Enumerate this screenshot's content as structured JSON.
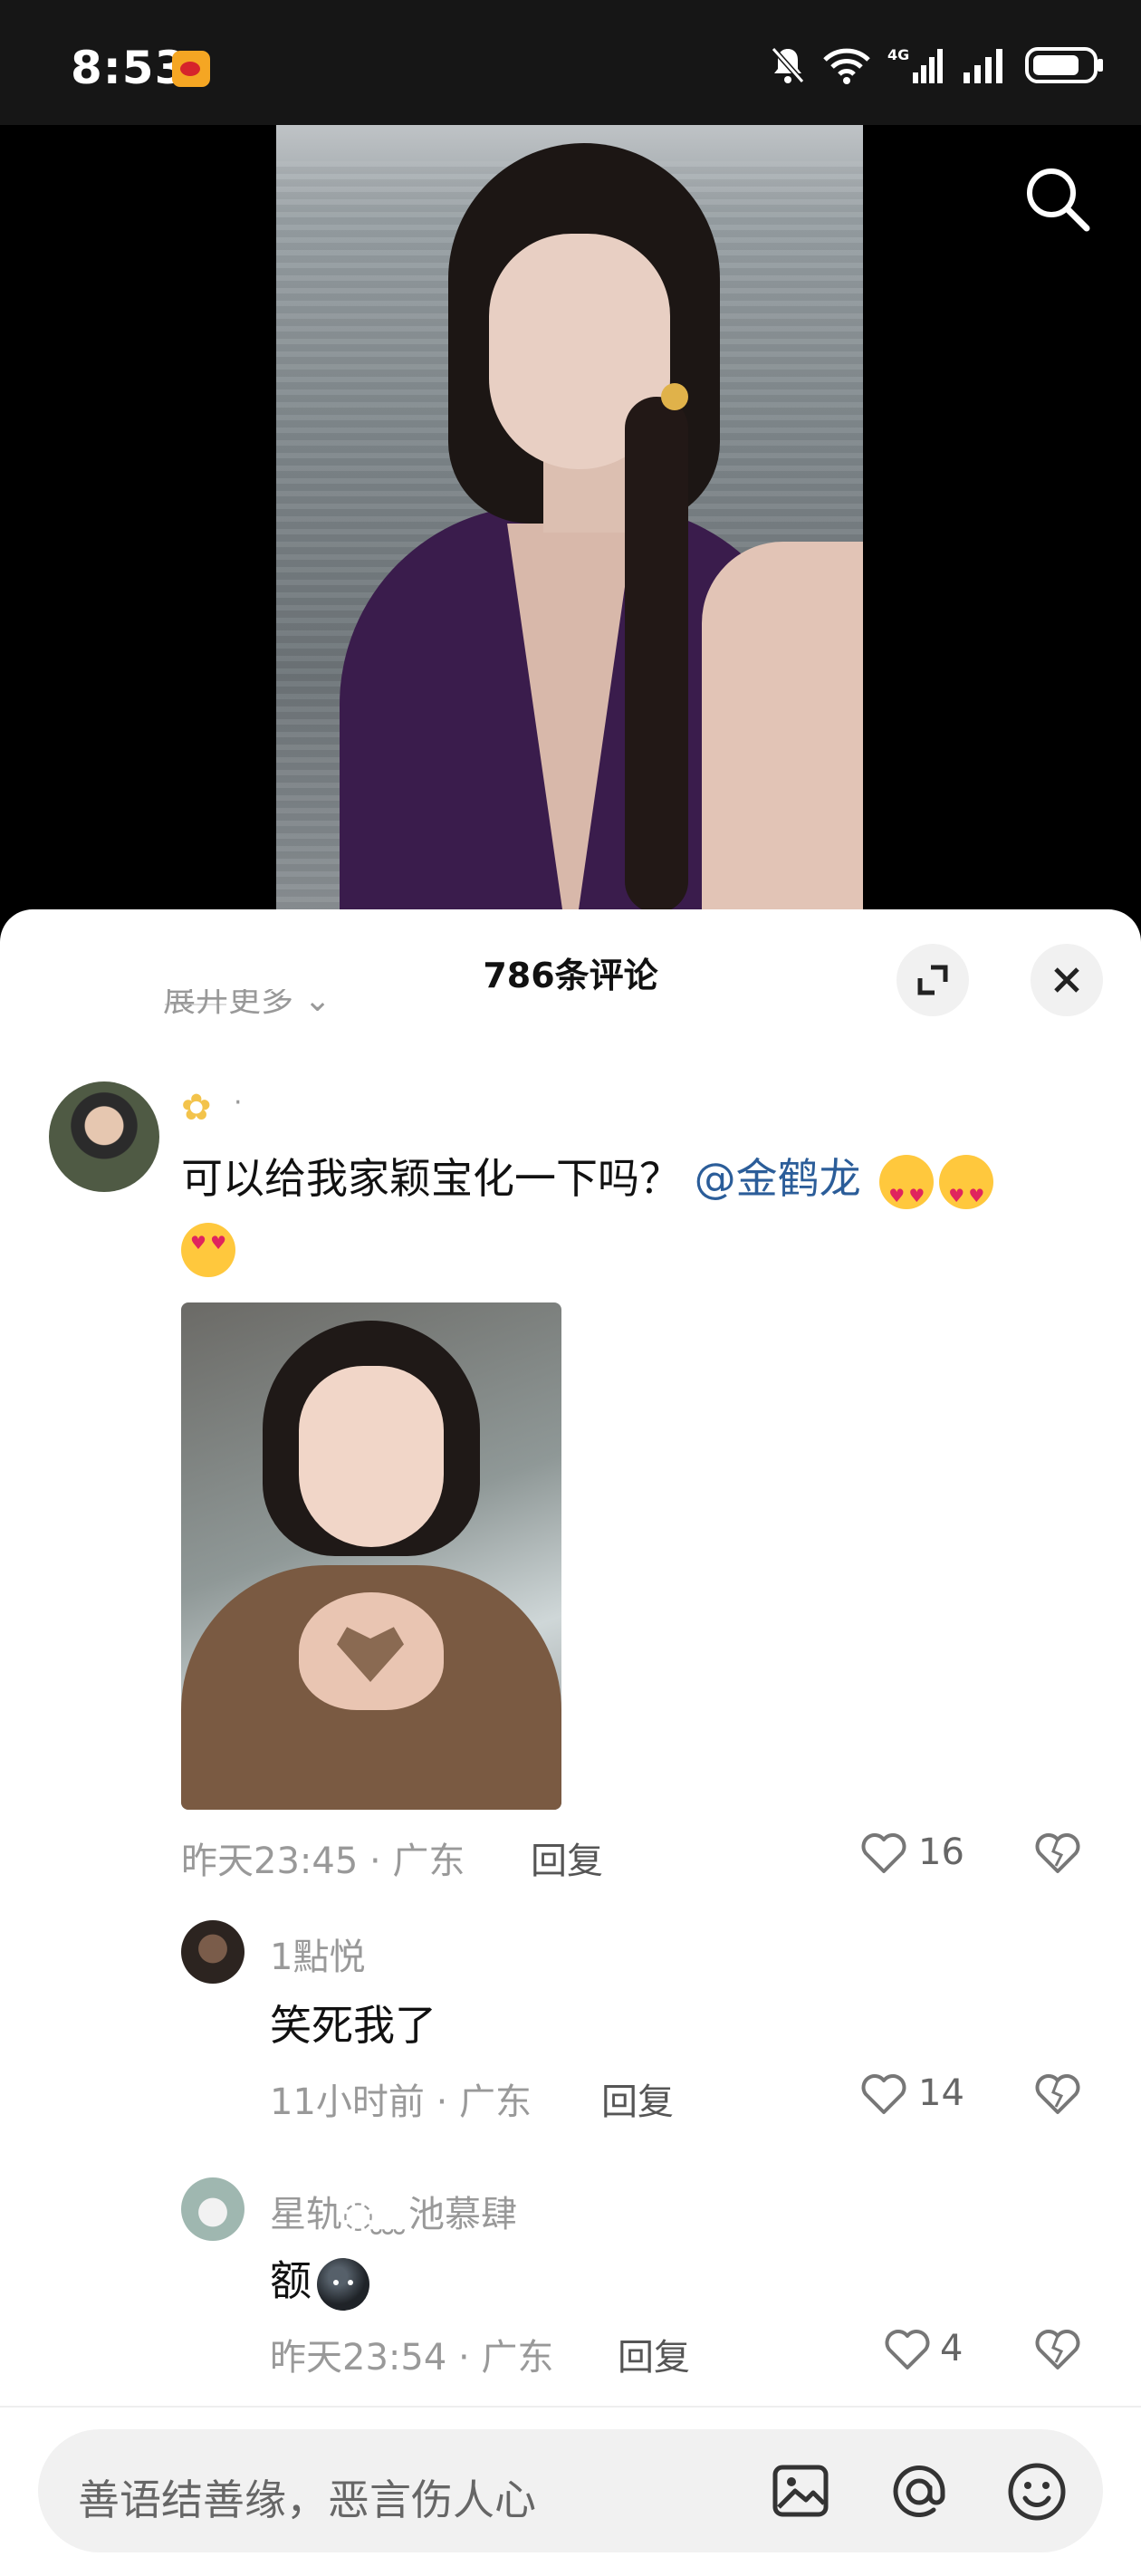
{
  "status_bar": {
    "time": "8:53",
    "app_icon": "weibo-icon",
    "icons": [
      "mute-bell-icon",
      "wifi-icon",
      "4g-signal-icon",
      "signal-icon",
      "battery-icon"
    ],
    "network_label": "4G"
  },
  "video": {
    "search_icon": "search-icon"
  },
  "comments_sheet": {
    "title": "786条评论",
    "expand_more": "展开更多",
    "main_comment": {
      "user_badge_icon": "flower-icon",
      "text": "可以给我家颖宝化一下吗？",
      "mention": "@金鹤龙",
      "emoji": "heart-eyes-emoji",
      "emoji_count": 3,
      "meta": "昨天23:45 · 广东",
      "reply_label": "回复",
      "likes": "16"
    },
    "replies": [
      {
        "name": "1點悦",
        "text": "笑死我了",
        "meta": "11小时前 · 广东",
        "reply_label": "回复",
        "likes": "14"
      },
      {
        "name": "星轨◌ ̮ ̮ ̮池慕肆",
        "text": "额",
        "emoji": "black-face-emoji",
        "meta": "昨天23:54 · 广东",
        "reply_label": "回复",
        "likes": "4"
      }
    ]
  },
  "input_bar": {
    "placeholder": "善语结善缘，恶言伤人心",
    "icons": [
      "image-icon",
      "at-icon",
      "emoji-icon"
    ]
  },
  "colors": {
    "accent_link": "#2b5d99",
    "meta_text": "#999999",
    "sheet_bg": "#ffffff"
  }
}
